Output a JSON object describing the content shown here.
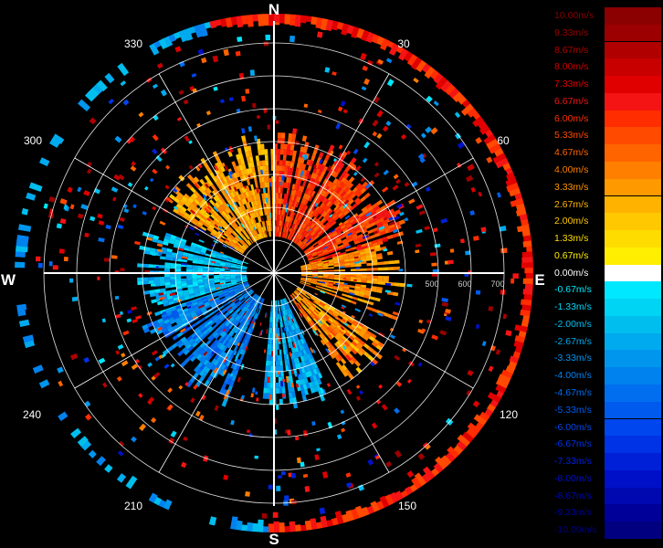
{
  "compass": {
    "north": "N",
    "south": "S",
    "east": "E",
    "west": "W"
  },
  "bearings": [
    "30",
    "60",
    "120",
    "150",
    "210",
    "240",
    "300",
    "330"
  ],
  "range_labels": [
    "500",
    "600",
    "700"
  ],
  "legend": [
    {
      "label": "10.00m/s",
      "color": "#8b0000"
    },
    {
      "label": "9.33m/s",
      "color": "#9c0000"
    },
    {
      "label": "8.67m/s",
      "color": "#b00000"
    },
    {
      "label": "8.00m/s",
      "color": "#c80000"
    },
    {
      "label": "7.33m/s",
      "color": "#e00000"
    },
    {
      "label": "6.67m/s",
      "color": "#f51414"
    },
    {
      "label": "6.00m/s",
      "color": "#ff2d00"
    },
    {
      "label": "5.33m/s",
      "color": "#ff4a00"
    },
    {
      "label": "4.67m/s",
      "color": "#ff6400"
    },
    {
      "label": "4.00m/s",
      "color": "#ff7f00"
    },
    {
      "label": "3.33m/s",
      "color": "#ff9900"
    },
    {
      "label": "2.67m/s",
      "color": "#ffb300"
    },
    {
      "label": "2.00m/s",
      "color": "#ffc800"
    },
    {
      "label": "1.33m/s",
      "color": "#ffdc00"
    },
    {
      "label": "0.67m/s",
      "color": "#ffee00"
    },
    {
      "label": "0.00m/s",
      "color": "#ffffff"
    },
    {
      "label": "-0.67m/s",
      "color": "#00e8ff"
    },
    {
      "label": "-1.33m/s",
      "color": "#00d4f5"
    },
    {
      "label": "-2.00m/s",
      "color": "#00bfee"
    },
    {
      "label": "-2.67m/s",
      "color": "#00aaee"
    },
    {
      "label": "-3.33m/s",
      "color": "#0096ee"
    },
    {
      "label": "-4.00m/s",
      "color": "#0082ee"
    },
    {
      "label": "-4.67m/s",
      "color": "#006eee"
    },
    {
      "label": "-5.33m/s",
      "color": "#005aee"
    },
    {
      "label": "-6.00m/s",
      "color": "#0046ee"
    },
    {
      "label": "-6.67m/s",
      "color": "#0032e6"
    },
    {
      "label": "-7.33m/s",
      "color": "#0020d8"
    },
    {
      "label": "-8.00m/s",
      "color": "#0010c8"
    },
    {
      "label": "-8.67m/s",
      "color": "#0008b0"
    },
    {
      "label": "-9.33m/s",
      "color": "#000098"
    },
    {
      "label": "-10.00m/s",
      "color": "#000080"
    }
  ]
}
